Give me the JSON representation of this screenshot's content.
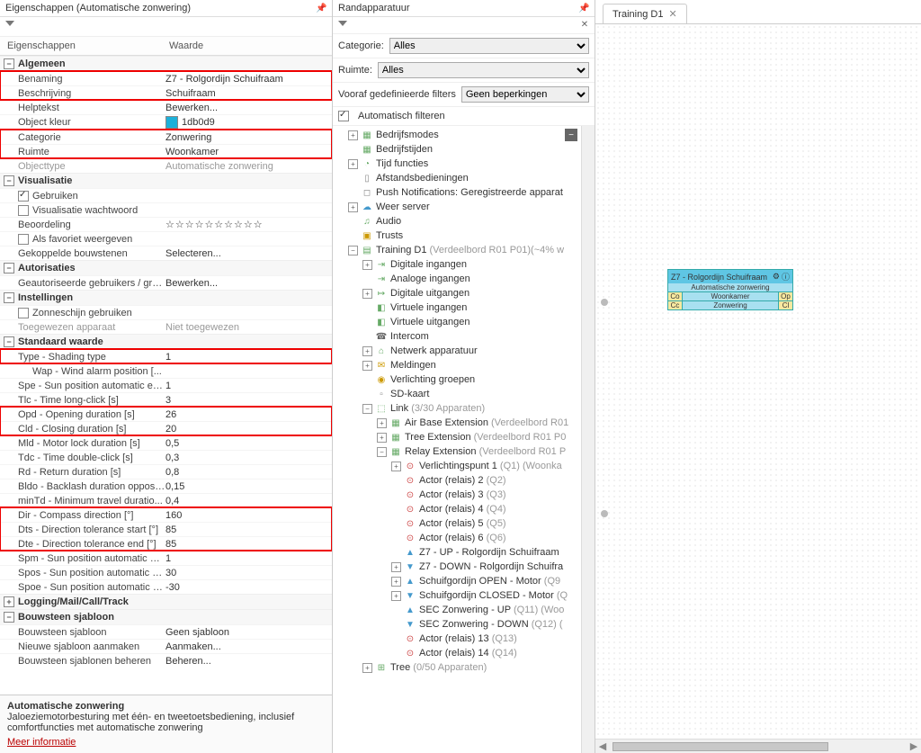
{
  "left": {
    "title": "Eigenschappen (Automatische zonwering)",
    "col_label": "Eigenschappen",
    "col_value": "Waarde",
    "groups": {
      "algemeen": {
        "title": "Algemeen",
        "benaming_l": "Benaming",
        "benaming_v": "Z7 - Rolgordijn Schuifraam",
        "beschr_l": "Beschrijving",
        "beschr_v": "Schuifraam",
        "help_l": "Helptekst",
        "help_v": "Bewerken...",
        "kleur_l": "Object kleur",
        "kleur_v": "1db0d9",
        "cat_l": "Categorie",
        "cat_v": "Zonwering",
        "ruimte_l": "Ruimte",
        "ruimte_v": "Woonkamer",
        "otype_l": "Objecttype",
        "otype_v": "Automatische zonwering"
      },
      "vis": {
        "title": "Visualisatie",
        "geb_l": "Gebruiken",
        "wacht_l": "Visualisatie wachtwoord",
        "beoor_l": "Beoordeling",
        "beoor_v": "☆☆☆☆☆☆☆☆☆☆",
        "fav_l": "Als favoriet weergeven",
        "koppel_l": "Gekoppelde bouwstenen",
        "koppel_v": "Selecteren..."
      },
      "auth": {
        "title": "Autorisaties",
        "users_l": "Geautoriseerde gebruikers / groe...",
        "users_v": "Bewerken..."
      },
      "inst": {
        "title": "Instellingen",
        "zon_l": "Zonneschijn gebruiken",
        "toeg_l": "Toegewezen apparaat",
        "toeg_v": "Niet toegewezen"
      },
      "std": {
        "title": "Standaard waarde",
        "type_l": "Type - Shading type",
        "type_v": "1",
        "wap_l": "Wap - Wind alarm position [...",
        "spe_l": "Spe - Sun position automatic en...",
        "spe_v": "1",
        "tlc_l": "Tlc - Time long-click [s]",
        "tlc_v": "3",
        "opd_l": "Opd - Opening duration [s]",
        "opd_v": "26",
        "cld_l": "Cld - Closing duration [s]",
        "cld_v": "20",
        "mld_l": "Mld - Motor lock duration [s]",
        "mld_v": "0,5",
        "tdc_l": "Tdc - Time double-click [s]",
        "tdc_v": "0,3",
        "rd_l": "Rd - Return duration [s]",
        "rd_v": "0,8",
        "bldo_l": "Bldo - Backlash duration opposit...",
        "bldo_v": "0,15",
        "mintd_l": "minTd - Minimum travel duratio...",
        "mintd_v": "0,4",
        "dir_l": "Dir - Compass direction [°]",
        "dir_v": "160",
        "dts_l": "Dts - Direction tolerance start [°]",
        "dts_v": "85",
        "dte_l": "Dte - Direction tolerance end [°]",
        "dte_v": "85",
        "spm_l": "Spm - Sun position automatic m...",
        "spm_v": "1",
        "spos_l": "Spos - Sun position automatic st...",
        "spos_v": "30",
        "spoe_l": "Spoe - Sun position automatic e...",
        "spoe_v": "-30"
      },
      "log": {
        "title": "Logging/Mail/Call/Track"
      },
      "tmpl": {
        "title": "Bouwsteen sjabloon",
        "sj_l": "Bouwsteen sjabloon",
        "sj_v": "Geen sjabloon",
        "new_l": "Nieuwe sjabloon aanmaken",
        "new_v": "Aanmaken...",
        "mgr_l": "Bouwsteen sjablonen beheren",
        "mgr_v": "Beheren..."
      }
    },
    "footer": {
      "title": "Automatische zonwering",
      "desc": "Jaloeziemotorbesturing met één- en tweetoetsbediening, inclusief comfortfuncties met automatische zonwering",
      "more": "Meer informatie"
    }
  },
  "mid": {
    "title": "Randapparatuur",
    "cat_label": "Categorie:",
    "cat_value": "Alles",
    "room_label": "Ruimte:",
    "room_value": "Alles",
    "predef_label": "Vooraf gedefinieerde filters",
    "predef_value": "Geen beperkingen",
    "autofilter": "Automatisch filteren",
    "tree": {
      "modes": "Bedrijfsmodes",
      "times": "Bedrijfstijden",
      "timefn": "Tijd functies",
      "remotes": "Afstandsbedieningen",
      "push": "Push Notifications: Geregistreerde apparat",
      "weather": "Weer server",
      "audio": "Audio",
      "trusts": "Trusts",
      "training": "Training D1",
      "training_dim": "(Verdeelbord R01 P01)(~4% w",
      "dig_in": "Digitale ingangen",
      "ana_in": "Analoge ingangen",
      "dig_out": "Digitale uitgangen",
      "virt_in": "Virtuele ingangen",
      "virt_out": "Virtuele uitgangen",
      "intercom": "Intercom",
      "netapp": "Netwerk apparatuur",
      "meld": "Meldingen",
      "lichtgrp": "Verlichting groepen",
      "sd": "SD-kaart",
      "link": "Link",
      "link_dim": "(3/30 Apparaten)",
      "airbase": "Air Base Extension",
      "airbase_dim": "(Verdeelbord R01",
      "treeext": "Tree Extension",
      "treeext_dim": "(Verdeelbord R01 P0",
      "relay": "Relay Extension",
      "relay_dim": "(Verdeelbord R01 P",
      "vp1": "Verlichtingspunt 1",
      "vp1_dim": "(Q1) (Woonka",
      "a2": "Actor (relais) 2",
      "a2_dim": "(Q2)",
      "a3": "Actor (relais) 3",
      "a3_dim": "(Q3)",
      "a4": "Actor (relais) 4",
      "a4_dim": "(Q4)",
      "a5": "Actor (relais) 5",
      "a5_dim": "(Q5)",
      "a6": "Actor (relais) 6",
      "a6_dim": "(Q6)",
      "z7up": "Z7 - UP - Rolgordijn Schuifraam",
      "z7dn": "Z7 - DOWN - Rolgordijn Schuifra",
      "sgopen": "Schuifgordijn OPEN - Motor",
      "sgopen_dim": "(Q9",
      "sgclosed": "Schuifgordijn CLOSED - Motor",
      "sgclosed_dim": "(Q",
      "secup": "SEC Zonwering - UP",
      "secup_dim": "(Q11) (Woo",
      "secdn": "SEC Zonwering - DOWN",
      "secdn_dim": "(Q12) (",
      "a13": "Actor (relais) 13",
      "a13_dim": "(Q13)",
      "a14": "Actor (relais) 14",
      "a14_dim": "(Q14)",
      "tree2": "Tree",
      "tree2_dim": "(0/50 Apparaten)"
    }
  },
  "right": {
    "tab": "Training D1",
    "block": {
      "title": "Z7 - Rolgordijn Schuifraam",
      "sub": "Automatische zonwering",
      "r1l": "Co",
      "r1m": "Woonkamer",
      "r1r": "Op",
      "r2l": "Cc",
      "r2m": "Zonwering",
      "r2r": "Cl"
    }
  }
}
